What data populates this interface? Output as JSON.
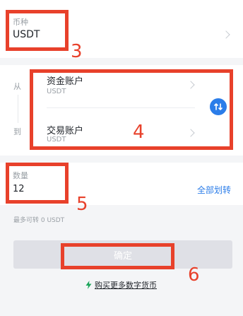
{
  "currency": {
    "label": "币种",
    "value": "USDT"
  },
  "transfer": {
    "from_label": "从",
    "to_label": "到",
    "from_account": {
      "name": "资金账户",
      "sub": "USDT"
    },
    "to_account": {
      "name": "交易账户",
      "sub": "USDT"
    }
  },
  "amount": {
    "label": "数量",
    "value": "12",
    "all_link": "全部划转"
  },
  "max_hint": "最多可转 0 USDT",
  "confirm_label": "确定",
  "buy_link": "购买更多数字货币",
  "annotations": {
    "n3": "3",
    "n4": "4",
    "n5": "5",
    "n6": "6"
  },
  "colors": {
    "accent": "#2b7de9",
    "annotation": "#e8412b",
    "swap_icon_bg": "#2b7de9"
  },
  "icons": {
    "chevron": "chevron-right-icon",
    "swap": "swap-vertical-icon",
    "lightning": "lightning-icon"
  }
}
